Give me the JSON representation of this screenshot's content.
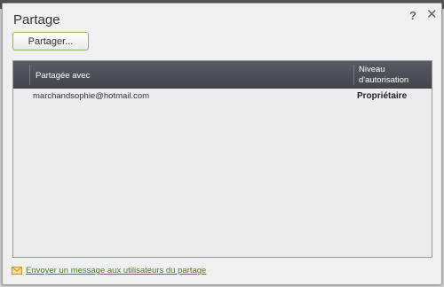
{
  "dialog": {
    "title": "Partage",
    "help_label": "?",
    "close_label": "✕",
    "share_button_label": "Partager..."
  },
  "table": {
    "columns": [
      "Partagée avec",
      "Niveau d'autorisation"
    ],
    "column_level_lines": [
      "Niveau",
      "d'autorisation"
    ],
    "rows": [
      {
        "email": "marchandsophie@hotmail.com",
        "role": "Propriétaire"
      }
    ]
  },
  "footer": {
    "icon": "envelope-icon",
    "link_label": "Envoyer un message aux utilisateurs du partage"
  },
  "colors": {
    "header_bg": "#4b4b52",
    "link": "#4d7f1e",
    "button_border": "#8fb36a",
    "envelope": "#d9a53a"
  }
}
